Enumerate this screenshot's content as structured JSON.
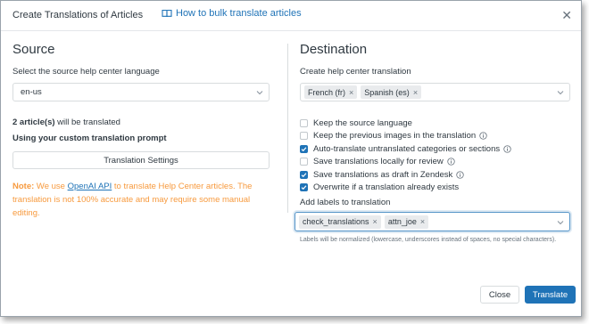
{
  "dialog": {
    "title": "Create Translations of Articles",
    "help_link": "How to bulk translate articles",
    "close_icon": "close-icon"
  },
  "source": {
    "heading": "Source",
    "language_label": "Select the source help center language",
    "language_value": "en-us",
    "count_bold": "2 article(s)",
    "count_rest": " will be translated",
    "custom_prompt_label": "Using your custom translation prompt",
    "settings_button": "Translation Settings",
    "note_prefix": "Note:",
    "note_text_1": " We use ",
    "note_link": "OpenAI API",
    "note_text_2": " to translate Help Center articles. The translation is not 100% accurate and may require some manual editing."
  },
  "destination": {
    "heading": "Destination",
    "create_label": "Create help center translation",
    "languages": [
      {
        "label": "French (fr)"
      },
      {
        "label": "Spanish (es)"
      }
    ],
    "options": [
      {
        "label": "Keep the source language",
        "checked": false,
        "info": false
      },
      {
        "label": "Keep the previous images in the translation",
        "checked": false,
        "info": true
      },
      {
        "label": "Auto-translate untranslated categories or sections",
        "checked": true,
        "info": true
      },
      {
        "label": "Save translations locally for review",
        "checked": false,
        "info": true
      },
      {
        "label": "Save translations as draft in Zendesk",
        "checked": true,
        "info": true
      },
      {
        "label": "Overwrite if a translation already exists",
        "checked": true,
        "info": false
      }
    ],
    "labels_label": "Add labels to translation",
    "labels": [
      {
        "label": "check_translations"
      },
      {
        "label": "attn_joe"
      }
    ],
    "labels_hint": "Labels will be normalized (lowercase, underscores instead of spaces, no special characters)."
  },
  "footer": {
    "close_button": "Close",
    "translate_button": "Translate"
  },
  "colors": {
    "accent": "#1f73b7",
    "note": "#f79a3e"
  }
}
